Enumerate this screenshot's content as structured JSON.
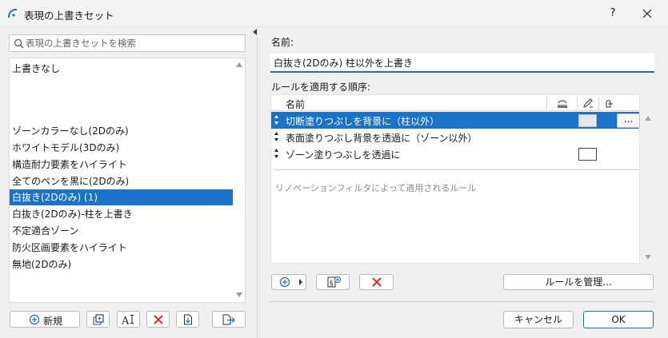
{
  "window": {
    "title": "表現の上書きセット",
    "help_label": "?"
  },
  "search": {
    "placeholder": "表現の上書きセットを検索"
  },
  "set_list": {
    "items": [
      {
        "label": "上書きなし"
      },
      {
        "label": "ゾーンカラーなし(2Dのみ)"
      },
      {
        "label": "ホワイトモデル(3Dのみ)"
      },
      {
        "label": "構造耐力要素をハイライト"
      },
      {
        "label": "全てのペンを黒に(2Dのみ)"
      },
      {
        "label": "白抜き(2Dのみ) (1)"
      },
      {
        "label": "白抜き(2Dのみ)-柱を上書き"
      },
      {
        "label": "不定適合ゾーン"
      },
      {
        "label": "防火区画要素をハイライト"
      },
      {
        "label": "無地(2Dのみ)"
      }
    ],
    "selected_index": 5
  },
  "left_toolbar": {
    "new_label": "新規"
  },
  "editor": {
    "name_label": "名前:",
    "name_value": "白抜き(2Dのみ) 柱以外を上書き",
    "order_label": "ルールを適用する順序:"
  },
  "rules_table": {
    "header_name": "名前",
    "rows": [
      {
        "label": "切断塗りつぶしを背景に（柱以外）"
      },
      {
        "label": "表面塗りつぶし背景を透過に（ゾーン以外）"
      },
      {
        "label": "ゾーン塗りつぶしを透過に"
      }
    ],
    "selected_index": 0,
    "more_label": "...",
    "renovation_text": "リノベーションフィルタによって適用されるルール"
  },
  "rules_toolbar": {
    "manage_label": "ルールを管理..."
  },
  "dialog": {
    "cancel_label": "キャンセル",
    "ok_label": "OK"
  },
  "colors": {
    "selection": "#1a73c8",
    "delete_red": "#d93025",
    "accent": "#1a6fc4"
  },
  "icons": {
    "title": "archicad-icon",
    "search": "search-icon",
    "new": "plus-circle-icon",
    "duplicate": "duplicate-icon",
    "rename": "rename-icon",
    "delete": "delete-x-icon",
    "import": "import-icon",
    "export": "export-icon",
    "add_rule": "plus-circle-icon",
    "rule_link": "rule-link-icon"
  }
}
